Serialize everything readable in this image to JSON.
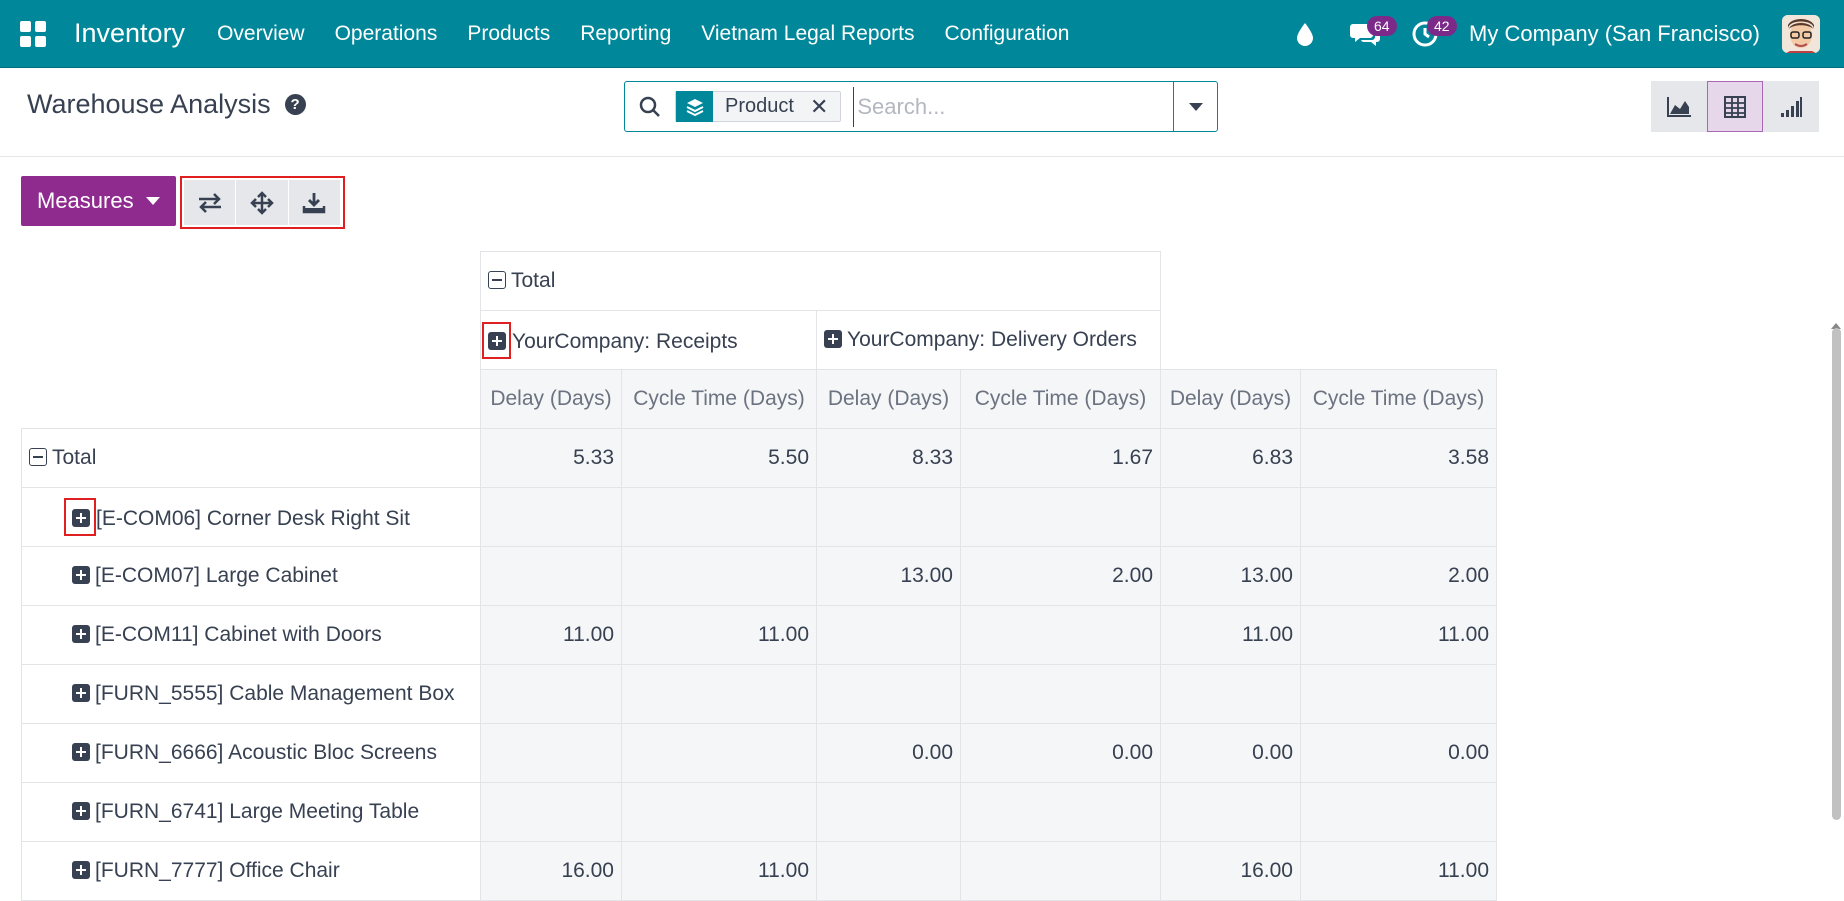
{
  "navbar": {
    "app_name": "Inventory",
    "menu": [
      "Overview",
      "Operations",
      "Products",
      "Reporting",
      "Vietnam Legal Reports",
      "Configuration"
    ],
    "messages_count": "64",
    "activities_count": "42",
    "company": "My Company (San Francisco)"
  },
  "control": {
    "title": "Warehouse Analysis",
    "help": "?",
    "facet_value": "Product",
    "facet_remove": "✕",
    "search_placeholder": "Search..."
  },
  "toolbar": {
    "measures_label": "Measures"
  },
  "pivot": {
    "col_total": "Total",
    "col_groups": [
      "YourCompany: Receipts",
      "YourCompany: Delivery Orders"
    ],
    "measures": [
      "Delay (Days)",
      "Cycle Time (Days)",
      "Delay (Days)",
      "Cycle Time (Days)",
      "Delay (Days)",
      "Cycle Time (Days)"
    ],
    "row_total_label": "Total",
    "total_values": [
      "5.33",
      "5.50",
      "8.33",
      "1.67",
      "6.83",
      "3.58"
    ],
    "rows": [
      {
        "label": "[E-COM06] Corner Desk Right Sit",
        "values": [
          "",
          "",
          "",
          "",
          "",
          ""
        ]
      },
      {
        "label": "[E-COM07] Large Cabinet",
        "values": [
          "",
          "",
          "13.00",
          "2.00",
          "13.00",
          "2.00"
        ]
      },
      {
        "label": "[E-COM11] Cabinet with Doors",
        "values": [
          "11.00",
          "11.00",
          "",
          "",
          "11.00",
          "11.00"
        ]
      },
      {
        "label": "[FURN_5555] Cable Management Box",
        "values": [
          "",
          "",
          "",
          "",
          "",
          ""
        ]
      },
      {
        "label": "[FURN_6666] Acoustic Bloc Screens",
        "values": [
          "",
          "",
          "0.00",
          "0.00",
          "0.00",
          "0.00"
        ]
      },
      {
        "label": "[FURN_6741] Large Meeting Table",
        "values": [
          "",
          "",
          "",
          "",
          "",
          ""
        ]
      },
      {
        "label": "[FURN_7777] Office Chair",
        "values": [
          "16.00",
          "11.00",
          "",
          "",
          "16.00",
          "11.00"
        ]
      }
    ]
  },
  "colors": {
    "navbar": "#00879a",
    "primary_button": "#8f2b8f",
    "highlight": "#e02020",
    "badge": "#7c2a8a"
  }
}
